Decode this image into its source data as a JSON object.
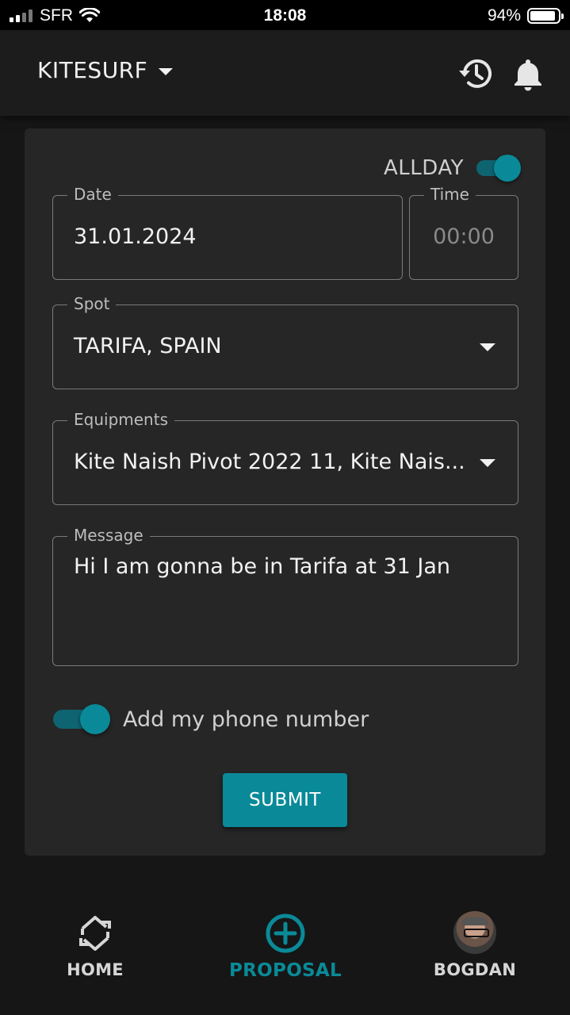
{
  "status_bar": {
    "carrier": "SFR",
    "time": "18:08",
    "battery": "94%"
  },
  "app_bar": {
    "title": "KITESURF",
    "icons": [
      "history-icon",
      "bell-icon"
    ]
  },
  "form": {
    "allday": {
      "label": "ALLDAY",
      "on": true
    },
    "date": {
      "label": "Date",
      "value": "31.01.2024"
    },
    "time": {
      "label": "Time",
      "placeholder": "00:00"
    },
    "spot": {
      "label": "Spot",
      "value": "TARIFA, SPAIN"
    },
    "equipments": {
      "label": "Equipments",
      "value": "Kite Naish Pivot 2022 11, Kite Nais..."
    },
    "message": {
      "label": "Message",
      "value": "Hi I am gonna be in Tarifa at 31 Jan"
    },
    "phone": {
      "label": "Add my phone number",
      "on": true
    },
    "submit_label": "SUBMIT"
  },
  "bottom_nav": {
    "items": [
      {
        "label": "HOME",
        "icon": "home-swap-icon"
      },
      {
        "label": "PROPOSAL",
        "icon": "add-circle-icon",
        "active": true
      },
      {
        "label": "BOGDAN",
        "icon": "avatar"
      }
    ]
  },
  "colors": {
    "accent": "#0a8a98",
    "background": "#161616",
    "card": "#262626"
  }
}
